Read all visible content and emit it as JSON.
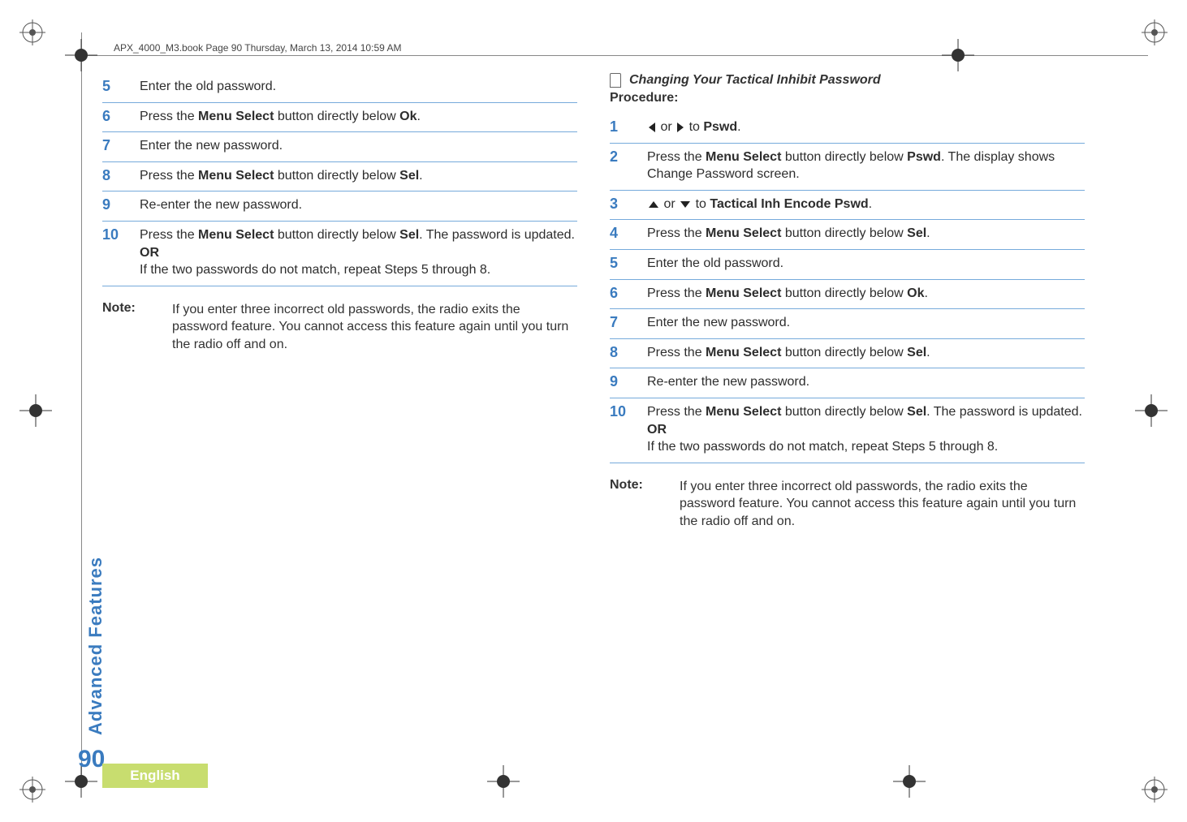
{
  "header": {
    "running": "APX_4000_M3.book  Page 90  Thursday, March 13, 2014  10:59 AM"
  },
  "left": {
    "steps": [
      {
        "num": "5",
        "text": "Enter the old password."
      },
      {
        "num": "6",
        "pre": "Press the ",
        "bold": "Menu Select",
        "mid": " button directly below ",
        "ui": "Ok",
        "post": "."
      },
      {
        "num": "7",
        "text": "Enter the new password."
      },
      {
        "num": "8",
        "pre": "Press the ",
        "bold": "Menu Select",
        "mid": " button directly below ",
        "ui": "Sel",
        "post": "."
      },
      {
        "num": "9",
        "text": "Re-enter the new password."
      },
      {
        "num": "10",
        "pre": "Press the ",
        "bold1": "Menu Select",
        "mid1": " button directly below ",
        "ui": "Sel",
        "mid2": ". The password is updated.",
        "or": "OR",
        "tail": "If the two passwords do not match, repeat Steps 5 through 8."
      }
    ],
    "note_label": "Note:",
    "note_body": "If you enter three incorrect old passwords, the radio exits the password feature. You cannot access this feature again until you turn the radio off and on."
  },
  "right": {
    "section_title": "Changing Your Tactical Inhibit Password",
    "procedure_label": "Procedure:",
    "steps": [
      {
        "num": "1",
        "nav_sides": true,
        "to": " to ",
        "ui": "Pswd",
        "post": "."
      },
      {
        "num": "2",
        "pre": "Press the ",
        "bold": "Menu Select",
        "mid": " button directly below ",
        "ui": "Pswd",
        "post": ". The display shows Change Password screen."
      },
      {
        "num": "3",
        "nav_updown": true,
        "to": " to ",
        "ui": "Tactical Inh Encode Pswd",
        "post": "."
      },
      {
        "num": "4",
        "pre": "Press the ",
        "bold": "Menu Select",
        "mid": " button directly below ",
        "ui": "Sel",
        "post": "."
      },
      {
        "num": "5",
        "text": "Enter the old password."
      },
      {
        "num": "6",
        "pre": "Press the ",
        "bold": "Menu Select",
        "mid": " button directly below ",
        "ui": "Ok",
        "post": "."
      },
      {
        "num": "7",
        "text": "Enter the new password."
      },
      {
        "num": "8",
        "pre": "Press the ",
        "bold": "Menu Select",
        "mid": " button directly below ",
        "ui": "Sel",
        "post": "."
      },
      {
        "num": "9",
        "text": "Re-enter the new password."
      },
      {
        "num": "10",
        "pre": "Press the ",
        "bold1": "Menu Select",
        "mid1": " button directly below ",
        "ui": "Sel",
        "mid2": ". The password is updated.",
        "or": "OR",
        "tail": "If the two passwords do not match, repeat Steps 5 through 8."
      }
    ],
    "note_label": "Note:",
    "note_body": "If you enter three incorrect old passwords, the radio exits the password feature. You cannot access this feature again until you turn the radio off and on."
  },
  "side": {
    "section_label": "Advanced Features",
    "page_number": "90",
    "language": "English"
  },
  "misc": {
    "or_word": " or "
  }
}
